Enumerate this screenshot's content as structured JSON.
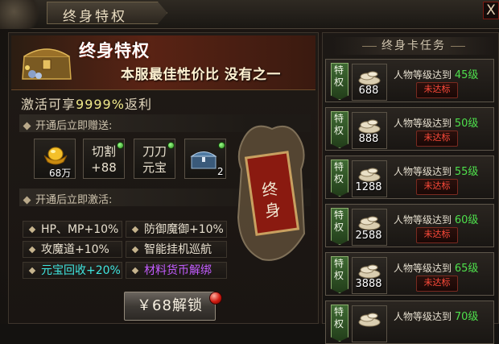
{
  "window": {
    "title": "终身特权",
    "close_label": "X"
  },
  "banner": {
    "title": "终身特权",
    "slogan": "本服最佳性价比 没有之一"
  },
  "activate": {
    "prefix": "激活可享",
    "value": "9999%",
    "suffix": "返利"
  },
  "gift_section": {
    "label": "开通后立即赠送:"
  },
  "gifts": [
    {
      "name": "gold-ingot",
      "qty": "68万"
    },
    {
      "name": "cut",
      "line1": "切割",
      "line2": "+88"
    },
    {
      "name": "blade-yuanbao",
      "line1": "刀刀",
      "line2": "元宝"
    },
    {
      "name": "treasure-chest",
      "qty": "2"
    }
  ],
  "activate_section": {
    "label": "开通后立即激活:"
  },
  "benefits": [
    {
      "text": "HP、MP+10%",
      "color": "#e8e0cf"
    },
    {
      "text": "防御魔御+10%",
      "color": "#e8e0cf"
    },
    {
      "text": "攻魔道+10%",
      "color": "#e8e0cf"
    },
    {
      "text": "智能挂机巡航",
      "color": "#e8e0cf"
    },
    {
      "text": "元宝回收+20%",
      "color": "#3fe6e0"
    },
    {
      "text": "材料货币解绑",
      "color": "#c35cff"
    }
  ],
  "unlock_button": {
    "label": "￥68解锁"
  },
  "plaque": {
    "text": "终身"
  },
  "tasks_panel": {
    "title": "终身卡任务"
  },
  "tasks": [
    {
      "badge": "特权",
      "coins": "688",
      "desc": "人物等级达到",
      "level": "45级",
      "status": "未达标"
    },
    {
      "badge": "特权",
      "coins": "888",
      "desc": "人物等级达到",
      "level": "50级",
      "status": "未达标"
    },
    {
      "badge": "特权",
      "coins": "1288",
      "desc": "人物等级达到",
      "level": "55级",
      "status": "未达标"
    },
    {
      "badge": "特权",
      "coins": "2588",
      "desc": "人物等级达到",
      "level": "60级",
      "status": "未达标"
    },
    {
      "badge": "特权",
      "coins": "3888",
      "desc": "人物等级达到",
      "level": "65级",
      "status": "未达标"
    },
    {
      "badge": "特权",
      "coins": "",
      "desc": "人物等级达到",
      "level": "70级",
      "status": ""
    }
  ]
}
